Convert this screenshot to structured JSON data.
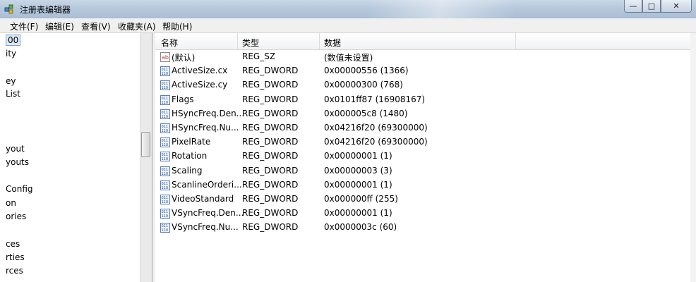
{
  "window": {
    "title": "注册表编辑器"
  },
  "menu": [
    {
      "label": "文件(F)"
    },
    {
      "label": "编辑(E)"
    },
    {
      "label": "查看(V)"
    },
    {
      "label": "收藏夹(A)"
    },
    {
      "label": "帮助(H)"
    }
  ],
  "tree": {
    "items": [
      {
        "label": "00",
        "selected": true
      },
      {
        "label": "ity"
      },
      {
        "label": "ey"
      },
      {
        "label": "List"
      },
      {
        "label": "yout"
      },
      {
        "label": "youts"
      },
      {
        "label": "Config"
      },
      {
        "label": "on"
      },
      {
        "label": "ories"
      },
      {
        "label": "ces"
      },
      {
        "label": "rties"
      },
      {
        "label": "rces"
      }
    ]
  },
  "list": {
    "headers": {
      "name": "名称",
      "type": "类型",
      "data": "数据"
    },
    "rows": [
      {
        "name": "(默认)",
        "type": "REG_SZ",
        "data": "(数值未设置)",
        "icon": "string-value-icon"
      },
      {
        "name": "ActiveSize.cx",
        "type": "REG_DWORD",
        "data": "0x00000556 (1366)",
        "icon": "binary-value-icon"
      },
      {
        "name": "ActiveSize.cy",
        "type": "REG_DWORD",
        "data": "0x00000300 (768)",
        "icon": "binary-value-icon"
      },
      {
        "name": "Flags",
        "type": "REG_DWORD",
        "data": "0x0101ff87 (16908167)",
        "icon": "binary-value-icon"
      },
      {
        "name": "HSyncFreq.Den...",
        "type": "REG_DWORD",
        "data": "0x000005c8 (1480)",
        "icon": "binary-value-icon"
      },
      {
        "name": "HSyncFreq.Nu...",
        "type": "REG_DWORD",
        "data": "0x04216f20 (69300000)",
        "icon": "binary-value-icon"
      },
      {
        "name": "PixelRate",
        "type": "REG_DWORD",
        "data": "0x04216f20 (69300000)",
        "icon": "binary-value-icon"
      },
      {
        "name": "Rotation",
        "type": "REG_DWORD",
        "data": "0x00000001 (1)",
        "icon": "binary-value-icon"
      },
      {
        "name": "Scaling",
        "type": "REG_DWORD",
        "data": "0x00000003 (3)",
        "icon": "binary-value-icon"
      },
      {
        "name": "ScanlineOrderi...",
        "type": "REG_DWORD",
        "data": "0x00000001 (1)",
        "icon": "binary-value-icon"
      },
      {
        "name": "VideoStandard",
        "type": "REG_DWORD",
        "data": "0x000000ff (255)",
        "icon": "binary-value-icon"
      },
      {
        "name": "VSyncFreq.Den...",
        "type": "REG_DWORD",
        "data": "0x00000001 (1)",
        "icon": "binary-value-icon"
      },
      {
        "name": "VSyncFreq.Nu...",
        "type": "REG_DWORD",
        "data": "0x0000003c (60)",
        "icon": "binary-value-icon"
      }
    ]
  }
}
